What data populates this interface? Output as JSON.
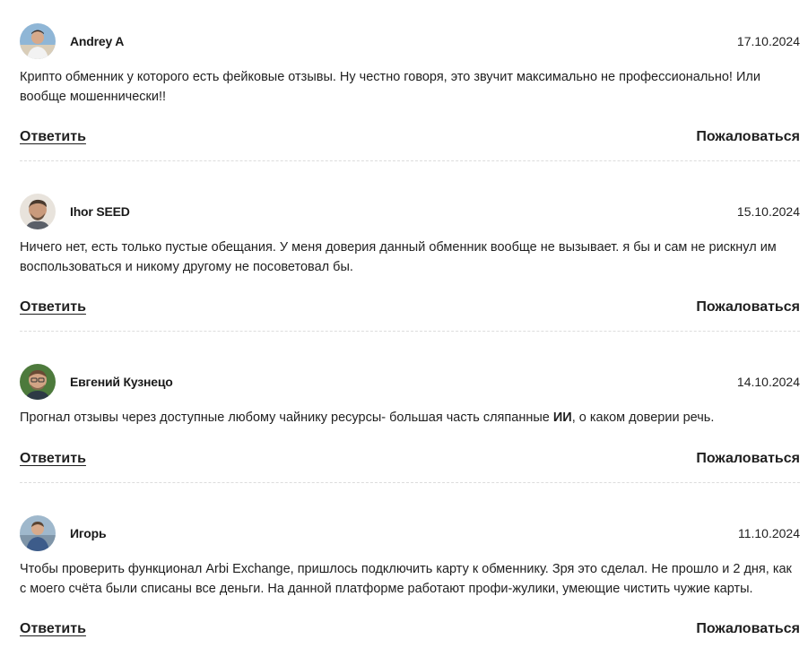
{
  "reviews": [
    {
      "author": "Andrey A",
      "date": "17.10.2024",
      "text": "Крипто обменник у которого есть фейковые отзывы. Ну честно говоря, это звучит максимально не профессионально! Или вообще мошеннически!!",
      "reply_label": "Ответить",
      "report_label": "Пожаловаться"
    },
    {
      "author": "Ihor SEED",
      "date": "15.10.2024",
      "text": "Ничего нет, есть только пустые обещания. У меня доверия данный обменник вообще не вызывает. я бы и сам не рискнул им воспользоваться и никому другому не посоветовал бы.",
      "reply_label": "Ответить",
      "report_label": "Пожаловаться"
    },
    {
      "author": "Евгений Кузнецо",
      "date": "14.10.2024",
      "text_before": "Прогнал отзывы через доступные любому чайнику ресурсы- большая часть сляпанные ",
      "text_bold": "ИИ",
      "text_after": ", о каком доверии речь.",
      "reply_label": "Ответить",
      "report_label": "Пожаловаться"
    },
    {
      "author": "Игорь",
      "date": "11.10.2024",
      "text": "Чтобы проверить функционал Arbi Exchange, пришлось подключить карту к обменнику. Зря это сделал. Не прошло и 2 дня, как с моего счёта были списаны все деньги. На данной платформе работают профи-жулики, умеющие чистить чужие карты.",
      "reply_label": "Ответить",
      "report_label": "Пожаловаться"
    }
  ]
}
